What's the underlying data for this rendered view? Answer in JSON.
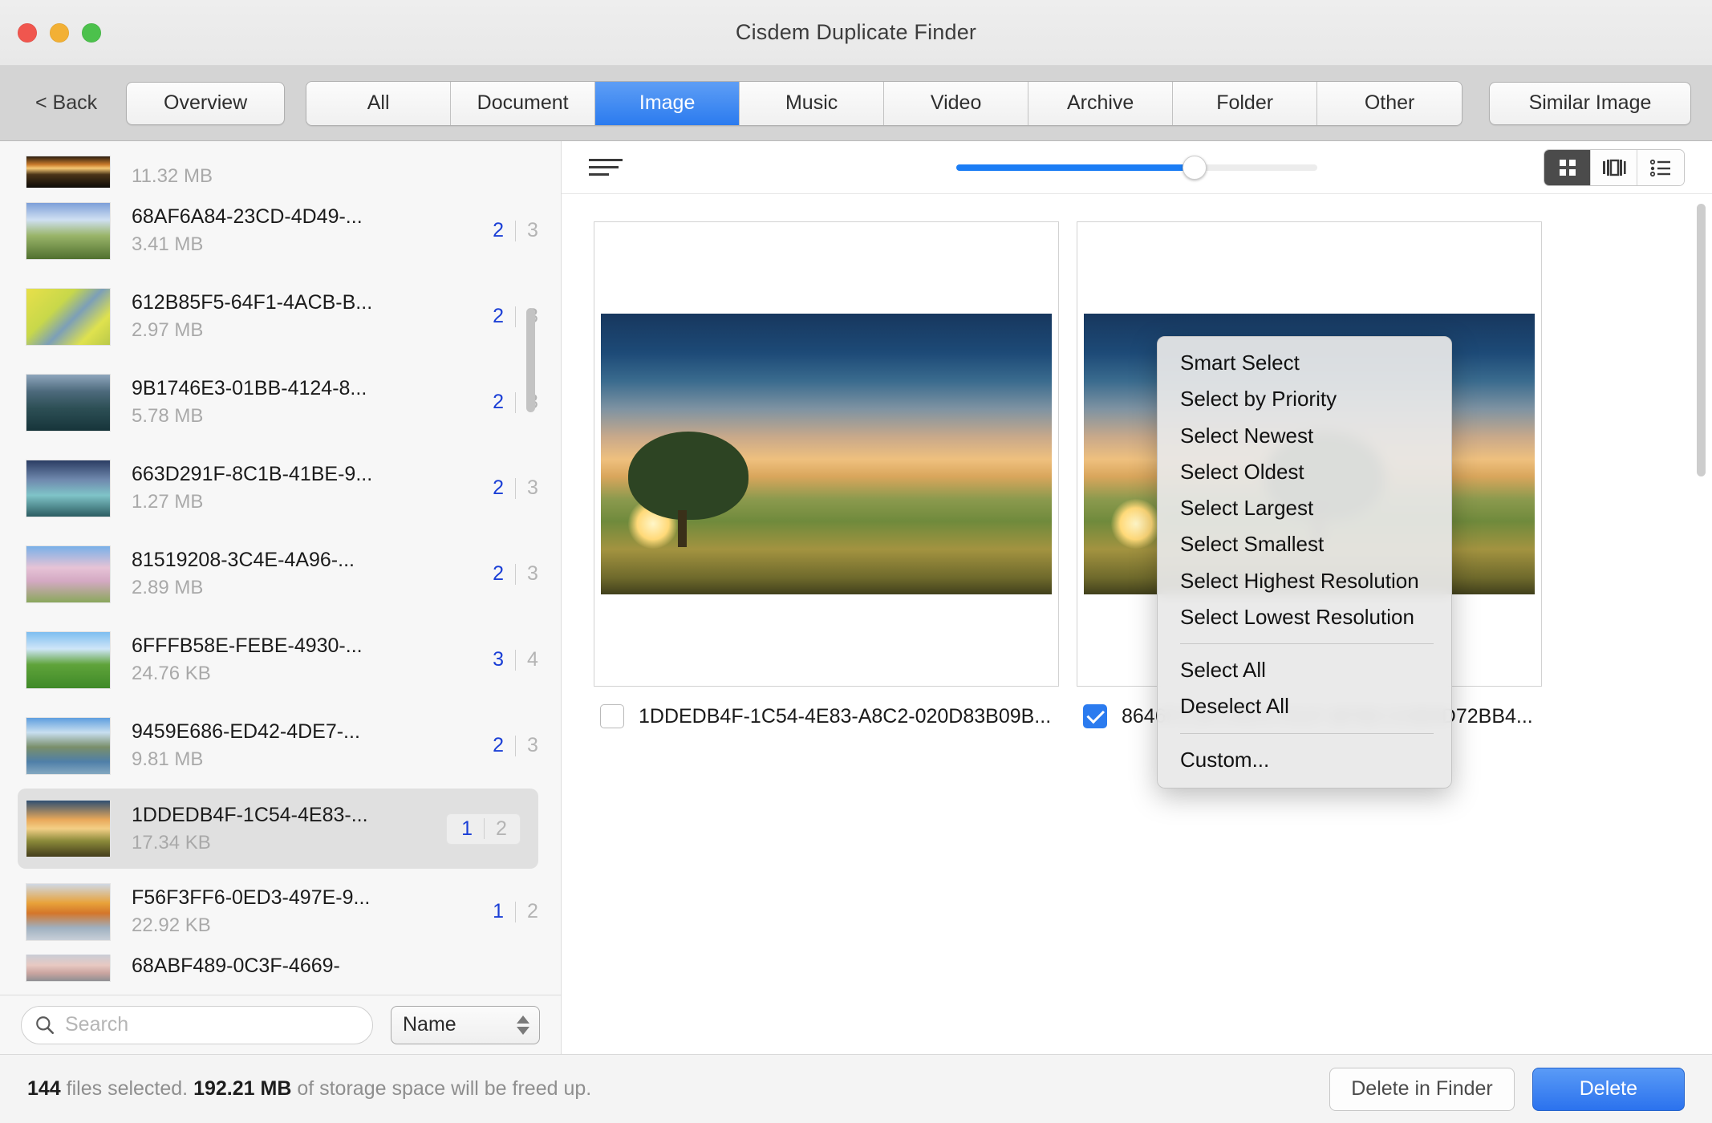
{
  "window": {
    "title": "Cisdem Duplicate Finder",
    "traffic_lights": [
      "close-button",
      "minimize-button",
      "zoom-button"
    ]
  },
  "toolbar": {
    "back_label": "< Back",
    "overview_label": "Overview",
    "categories": [
      {
        "label": "All",
        "active": false
      },
      {
        "label": "Document",
        "active": false
      },
      {
        "label": "Image",
        "active": true
      },
      {
        "label": "Music",
        "active": false
      },
      {
        "label": "Video",
        "active": false
      },
      {
        "label": "Archive",
        "active": false
      },
      {
        "label": "Folder",
        "active": false
      },
      {
        "label": "Other",
        "active": false
      }
    ],
    "similar_image_label": "Similar Image"
  },
  "sidebar": {
    "files": [
      {
        "name": "",
        "size": "11.32 MB",
        "selected_count": "",
        "total_count": "",
        "row_selected": false,
        "partial_top": true
      },
      {
        "name": "68AF6A84-23CD-4D49-...",
        "size": "3.41 MB",
        "selected_count": "2",
        "total_count": "3",
        "row_selected": false
      },
      {
        "name": "612B85F5-64F1-4ACB-B...",
        "size": "2.97 MB",
        "selected_count": "2",
        "total_count": "3",
        "row_selected": false
      },
      {
        "name": "9B1746E3-01BB-4124-8...",
        "size": "5.78 MB",
        "selected_count": "2",
        "total_count": "3",
        "row_selected": false
      },
      {
        "name": "663D291F-8C1B-41BE-9...",
        "size": "1.27 MB",
        "selected_count": "2",
        "total_count": "3",
        "row_selected": false
      },
      {
        "name": "81519208-3C4E-4A96-...",
        "size": "2.89 MB",
        "selected_count": "2",
        "total_count": "3",
        "row_selected": false
      },
      {
        "name": "6FFFB58E-FEBE-4930-...",
        "size": "24.76 KB",
        "selected_count": "3",
        "total_count": "4",
        "row_selected": false
      },
      {
        "name": "9459E686-ED42-4DE7-...",
        "size": "9.81 MB",
        "selected_count": "2",
        "total_count": "3",
        "row_selected": false
      },
      {
        "name": "1DDEDB4F-1C54-4E83-...",
        "size": "17.34 KB",
        "selected_count": "1",
        "total_count": "2",
        "row_selected": true
      },
      {
        "name": "F56F3FF6-0ED3-497E-9...",
        "size": "22.92 KB",
        "selected_count": "1",
        "total_count": "2",
        "row_selected": false
      },
      {
        "name": "68ABF489-0C3F-4669-",
        "size": "",
        "selected_count": "",
        "total_count": "",
        "row_selected": false,
        "partial_bottom": true
      }
    ],
    "search": {
      "placeholder": "Search",
      "value": ""
    },
    "sort": {
      "selected": "Name"
    }
  },
  "content": {
    "menu_icon": "hamburger-icon",
    "zoom_slider": {
      "value_percent": 66
    },
    "view_modes": [
      {
        "name": "grid-view",
        "active": true
      },
      {
        "name": "coverflow-view",
        "active": false
      },
      {
        "name": "list-view",
        "active": false
      }
    ],
    "cards": [
      {
        "name": "1DDEDB4F-1C54-4E83-A8C2-020D83B09B...",
        "checked": false
      },
      {
        "name": "8646FC3A-04D4-431F-BFBD-D3B9D72BB4...",
        "checked": true
      }
    ]
  },
  "context_menu": {
    "groups": [
      [
        "Smart Select",
        "Select by Priority",
        "Select Newest",
        "Select Oldest",
        "Select Largest",
        "Select Smallest",
        "Select Highest Resolution",
        "Select Lowest Resolution"
      ],
      [
        "Select All",
        "Deselect All"
      ],
      [
        "Custom..."
      ]
    ]
  },
  "footer": {
    "status_count": "144",
    "status_mid": " files selected. ",
    "status_size": "192.21 MB",
    "status_tail": " of storage space will be freed up.",
    "delete_in_finder_label": "Delete in Finder",
    "delete_label": "Delete"
  },
  "colors": {
    "accent_blue": "#2b7bef",
    "count_blue": "#1b3fd6",
    "muted_gray": "#a9a9a9"
  }
}
